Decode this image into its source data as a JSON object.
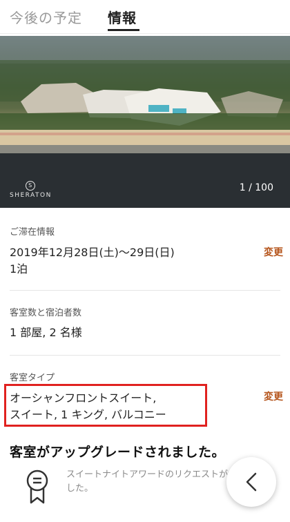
{
  "tabs": [
    {
      "label": "今後の予定",
      "active": false
    },
    {
      "label": "情報",
      "active": true
    }
  ],
  "hero": {
    "brand_name": "SHERATON",
    "image_counter": "1 / 100"
  },
  "stay_info": {
    "label": "ご滞在情報",
    "dates": "2019年12月28日(土)〜29日(日)",
    "nights": "1泊",
    "change_label": "変更"
  },
  "rooms_guests": {
    "label": "客室数と宿泊者数",
    "value": "1 部屋, 2 名様"
  },
  "room_type": {
    "label": "客室タイプ",
    "line1": "オーシャンフロントスイート,",
    "line2": "スイート, 1 キング, バルコニー",
    "change_label": "変更"
  },
  "upgrade": {
    "title": "客室がアップグレードされました。",
    "message": "スイートナイトアワードのリクエストが承認されました。"
  },
  "colors": {
    "accent": "#b5541b",
    "highlight_border": "#e0211f"
  },
  "icons": {
    "badge": "award-ribbon-icon",
    "back": "chevron-left-icon"
  }
}
